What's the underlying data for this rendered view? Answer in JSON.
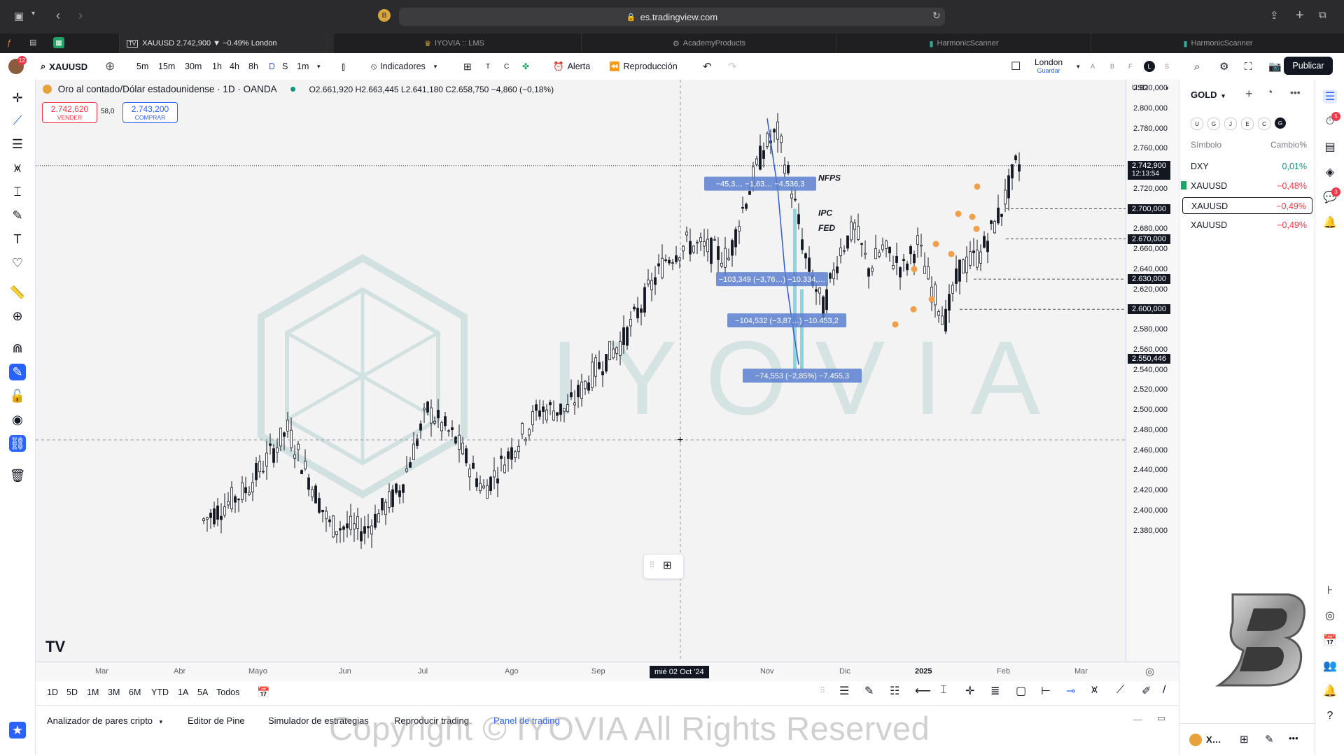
{
  "browser": {
    "url": "es.tradingview.com",
    "tabs": [
      {
        "label": "XAUUSD 2.742,900 ▼ −0.49% London",
        "active": true
      },
      {
        "label": "IYOVIA :: LMS"
      },
      {
        "label": "AcademyProducts"
      },
      {
        "label": "HarmonicScanner"
      },
      {
        "label": "HarmonicScanner"
      }
    ]
  },
  "toolbar": {
    "symbol": "XAUUSD",
    "intervals": [
      "5m",
      "15m",
      "30m",
      "1h",
      "4h",
      "8h",
      "D",
      "S",
      "1m"
    ],
    "indicators_label": "Indicadores",
    "alert_label": "Alerta",
    "replay_label": "Reproducción",
    "layout_name": "London",
    "layout_save": "Guardar",
    "publish_label": "Publicar"
  },
  "legend": {
    "title": "Oro al contado/Dólar estadounidense · 1D · OANDA",
    "ohlc": "O2.661,920 H2.663,445 L2.641,180 C2.658,750 −4,860 (−0,18%)",
    "sell_price": "2.742,620",
    "sell_label": "VENDER",
    "spread": "58,0",
    "buy_price": "2.743,200",
    "buy_label": "COMPRAR"
  },
  "chart_data": {
    "type": "candlestick",
    "currency": "USD",
    "y_ticks": [
      "2.820,000",
      "2.800,000",
      "2.780,000",
      "2.760,000",
      "2.720,000",
      "2.680,000",
      "2.660,000",
      "2.640,000",
      "2.620,000",
      "2.580,000",
      "2.560,000",
      "2.540,000",
      "2.520,000",
      "2.500,000",
      "2.480,000",
      "2.460,000",
      "2.440,000",
      "2.420,000",
      "2.400,000",
      "2.380,000"
    ],
    "y_ticks_values": [
      2820,
      2800,
      2780,
      2760,
      2720,
      2680,
      2660,
      2640,
      2620,
      2580,
      2560,
      2540,
      2520,
      2500,
      2480,
      2460,
      2440,
      2420,
      2400,
      2380
    ],
    "price_tags": [
      {
        "label": "2.742,900",
        "sub": "12:13:54",
        "value": 2742.9
      },
      {
        "label": "2.700,000",
        "value": 2700
      },
      {
        "label": "2.670,000",
        "value": 2670
      },
      {
        "label": "2.630,000",
        "value": 2630
      },
      {
        "label": "2.600,000",
        "value": 2600
      },
      {
        "label": "2.550,446",
        "value": 2550.446
      }
    ],
    "x_ticks": [
      "Mar",
      "Abr",
      "Mayo",
      "Jun",
      "Jul",
      "Ago",
      "Sep",
      "Nov",
      "Dic",
      "2025",
      "Feb",
      "Mar"
    ],
    "crosshair_date": "mié 02 Oct '24",
    "measure_labels": [
      {
        "text": "−45,3… −1,63… −4.536,3",
        "value": 2725
      },
      {
        "text": "−103,349 (−3,76…) −10.334,…",
        "value": 2630
      },
      {
        "text": "−104,532 (−3,87…) −10.453,2",
        "value": 2589
      },
      {
        "text": "−74,553 (−2,85%) −7.455,3",
        "value": 2534
      }
    ],
    "annotations": [
      "NFPS",
      "IPC",
      "FED"
    ],
    "last_price": 2742.9
  },
  "watermark": "IYOVIA",
  "ranges": [
    "1D",
    "5D",
    "1M",
    "3M",
    "6M",
    "YTD",
    "1A",
    "5A",
    "Todos"
  ],
  "bottom_tabs": [
    "Analizador de pares cripto",
    "Editor de Pine",
    "Simulador de estrategias",
    "Reproducir trading",
    "Panel de trading"
  ],
  "watchlist": {
    "title": "GOLD",
    "col_symbol": "Símbolo",
    "col_change": "Cambio%",
    "flags": [
      "U",
      "G",
      "J",
      "E",
      "C",
      "G"
    ],
    "rows": [
      {
        "symbol": "DXY",
        "change": "0,01%",
        "color": "#089981"
      },
      {
        "symbol": "XAUUSD",
        "change": "−0,48%",
        "color": "#f23645"
      },
      {
        "symbol": "XAUUSD",
        "change": "−0,49%",
        "color": "#f23645"
      },
      {
        "symbol": "XAUUSD",
        "change": "−0,49%",
        "color": "#f23645"
      }
    ],
    "footer_symbol": "X…"
  },
  "copyright": "Copyright © IYOVIA All Rights Reserved",
  "colors": {
    "accent": "#2962ff",
    "down": "#f23645",
    "up": "#089981",
    "measure": "#5b7ecf"
  }
}
